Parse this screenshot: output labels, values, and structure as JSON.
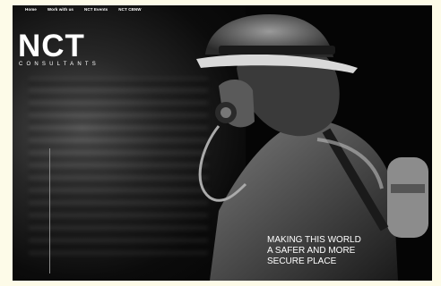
{
  "nav": {
    "items": [
      "Home",
      "Work with us",
      "NCT Events",
      "NCT CBNW"
    ]
  },
  "brand": {
    "mark": "NCT",
    "tagline": "CONSULTANTS"
  },
  "hero": {
    "lines": [
      "MAKING THIS WORLD",
      "A SAFER AND MORE",
      "SECURE PLACE"
    ]
  },
  "colors": {
    "background": "#050505",
    "text": "#ffffff",
    "page": "#fdfbe8"
  }
}
